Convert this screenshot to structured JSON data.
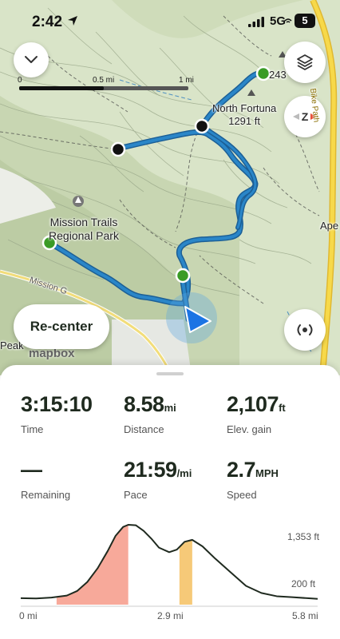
{
  "status_bar": {
    "time": "2:42",
    "network": "5G",
    "battery": "5"
  },
  "map": {
    "scale": {
      "start": "0",
      "mid": "0.5 mi",
      "end": "1 mi"
    },
    "labels": {
      "park": "Mission Trails Regional Park",
      "peak": "North Fortuna",
      "peak_elevation": "1291 ft",
      "peak_partial": "243",
      "ape_partial": "Ape",
      "road": "Mission G",
      "peak_left": "Peak",
      "bike_path": "Bike Path",
      "attribution": "mapbox"
    },
    "recenter_label": "Re-center",
    "track_color": "#2a86c8",
    "start_marker_color": "#3a9b26"
  },
  "stats": [
    {
      "value": "3:15:10",
      "unit": "",
      "label": "Time"
    },
    {
      "value": "8.58",
      "unit": "mi",
      "label": "Distance"
    },
    {
      "value": "2,107",
      "unit": "ft",
      "label": "Elev. gain"
    },
    {
      "value": "—",
      "unit": "",
      "label": "Remaining"
    },
    {
      "value": "21:59",
      "unit": "/mi",
      "label": "Pace"
    },
    {
      "value": "2.7",
      "unit": "MPH",
      "label": "Speed"
    }
  ],
  "elevation_profile": {
    "max_label": "1,353 ft",
    "min_label": "200 ft",
    "x_start": "0 mi",
    "x_mid": "2.9 mi",
    "x_end": "5.8 mi",
    "climb_color": "#f7a99a",
    "highlight_color": "#f6c978",
    "points": [
      [
        0,
        220
      ],
      [
        0.3,
        215
      ],
      [
        0.6,
        230
      ],
      [
        0.9,
        260
      ],
      [
        1.1,
        330
      ],
      [
        1.3,
        470
      ],
      [
        1.5,
        680
      ],
      [
        1.7,
        950
      ],
      [
        1.85,
        1180
      ],
      [
        2.0,
        1320
      ],
      [
        2.1,
        1353
      ],
      [
        2.25,
        1345
      ],
      [
        2.4,
        1260
      ],
      [
        2.55,
        1140
      ],
      [
        2.7,
        1000
      ],
      [
        2.9,
        930
      ],
      [
        3.05,
        970
      ],
      [
        3.2,
        1090
      ],
      [
        3.35,
        1120
      ],
      [
        3.55,
        1020
      ],
      [
        3.8,
        830
      ],
      [
        4.1,
        620
      ],
      [
        4.4,
        410
      ],
      [
        4.7,
        300
      ],
      [
        5.0,
        250
      ],
      [
        5.3,
        235
      ],
      [
        5.6,
        220
      ],
      [
        5.8,
        210
      ]
    ],
    "climb_range_mi": [
      0.7,
      2.1
    ],
    "highlight_range_mi": [
      3.1,
      3.35
    ]
  }
}
